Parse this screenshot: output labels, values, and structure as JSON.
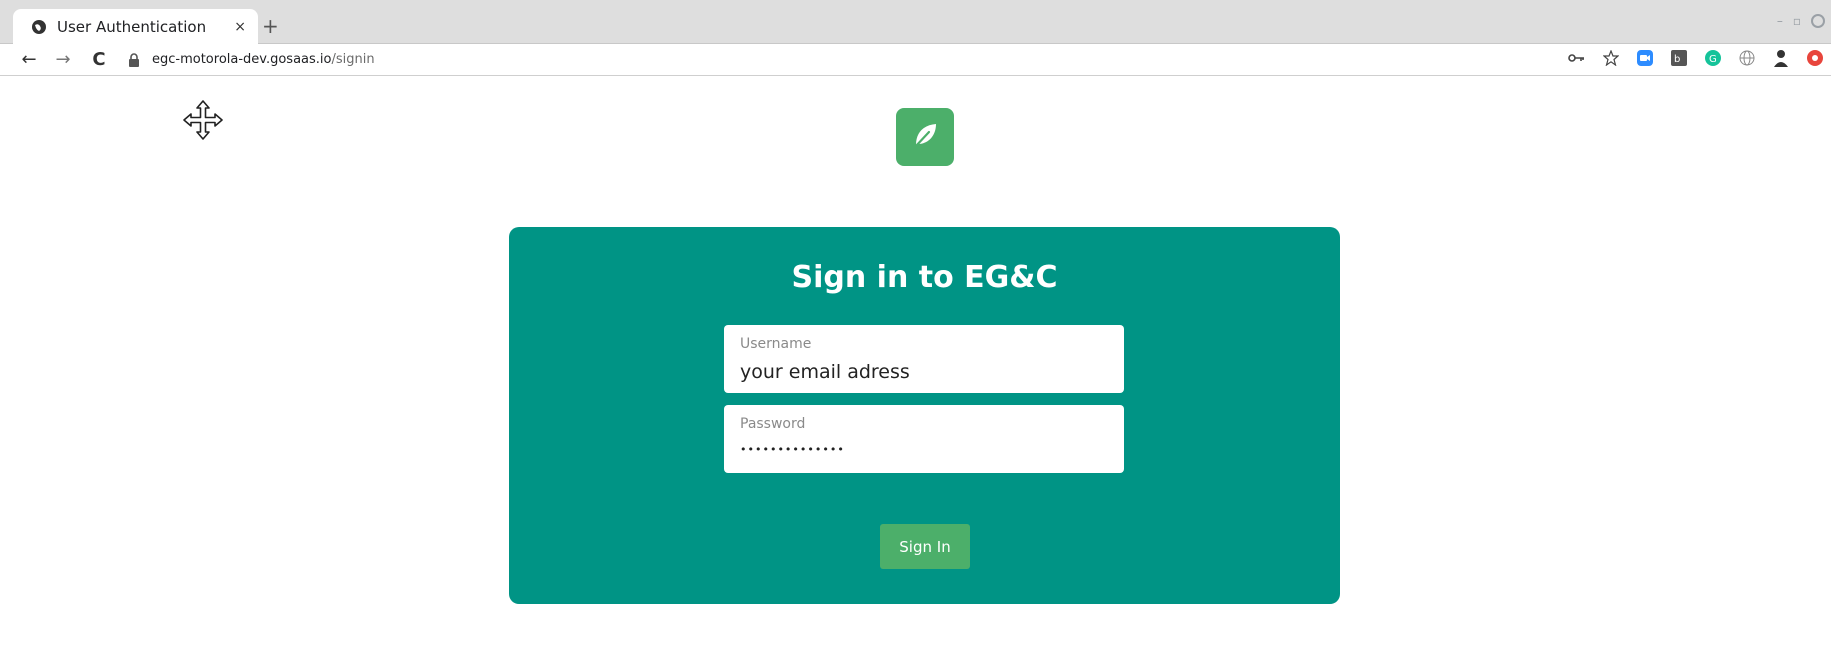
{
  "browser": {
    "tab": {
      "title": "User Authentication",
      "close": "×"
    },
    "new_tab": "+",
    "window_controls": {
      "minimize": "–",
      "maximize": "▫"
    },
    "nav": {
      "back": "←",
      "forward": "→",
      "reload": "C"
    },
    "url": {
      "host": "egc-motorola-dev.gosaas.io",
      "path": "/signin"
    },
    "extensions": [
      "key-icon",
      "star-icon",
      "zoom-extension-icon",
      "extension-icon",
      "grammarly-icon",
      "globe-icon",
      "profile-avatar",
      "extension-red-icon"
    ]
  },
  "page": {
    "logo_icon": "leaf-icon",
    "card": {
      "title": "Sign in to EG&C",
      "username": {
        "label": "Username",
        "value": "your email adress"
      },
      "password": {
        "label": "Password",
        "value": "••••••••••••••"
      },
      "submit_label": "Sign In"
    }
  },
  "colors": {
    "card_bg": "#009485",
    "logo_bg": "#4caf6a",
    "button_bg": "#4caf6a"
  }
}
